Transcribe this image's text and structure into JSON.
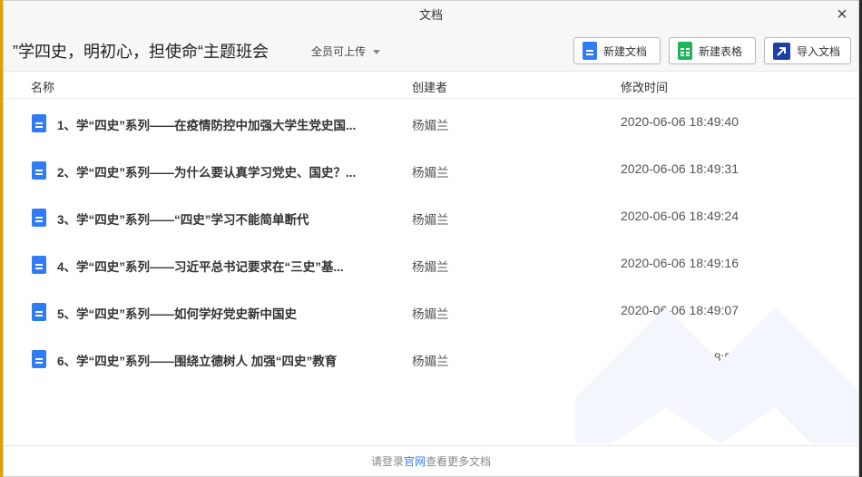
{
  "window": {
    "title": "文档"
  },
  "header": {
    "title": "”学四史，明初心，担使命“主题班会",
    "upload_permission": "全员可上传",
    "buttons": {
      "new_doc": "新建文档",
      "new_sheet": "新建表格",
      "import_doc": "导入文档"
    }
  },
  "columns": {
    "name": "名称",
    "creator": "创建者",
    "modified": "修改时间"
  },
  "files": [
    {
      "name": "1、学“四史”系列——在疫情防控中加强大学生党史国...",
      "creator": "杨媚兰",
      "modified": "2020-06-06 18:49:40"
    },
    {
      "name": "2、学“四史”系列——为什么要认真学习党史、国史？...",
      "creator": "杨媚兰",
      "modified": "2020-06-06 18:49:31"
    },
    {
      "name": "3、学“四史”系列——“四史”学习不能简单断代",
      "creator": "杨媚兰",
      "modified": "2020-06-06 18:49:24"
    },
    {
      "name": "4、学“四史”系列——习近平总书记要求在“三史”基...",
      "creator": "杨媚兰",
      "modified": "2020-06-06 18:49:16"
    },
    {
      "name": "5、学“四史”系列——如何学好党史新中国史",
      "creator": "杨媚兰",
      "modified": "2020-06-06 18:49:07"
    },
    {
      "name": "6、学“四史”系列——围绕立德树人 加强“四史”教育",
      "creator": "杨媚兰",
      "modified": "2020-06-06 18:48:57"
    }
  ],
  "footer": {
    "prefix": "请登录",
    "link": "官网",
    "suffix": "查看更多文档"
  },
  "icons": {
    "doc_icon": "doc-icon",
    "sheet_icon": "sheet-icon",
    "import_icon": "import-icon",
    "close_icon": "close-icon",
    "caret_icon": "caret-down-icon"
  },
  "colors": {
    "doc_blue": "#2f7cf6",
    "sheet_green": "#1fb35b",
    "import_navy": "#1d3fa8",
    "link_blue": "#2f7cf6"
  }
}
